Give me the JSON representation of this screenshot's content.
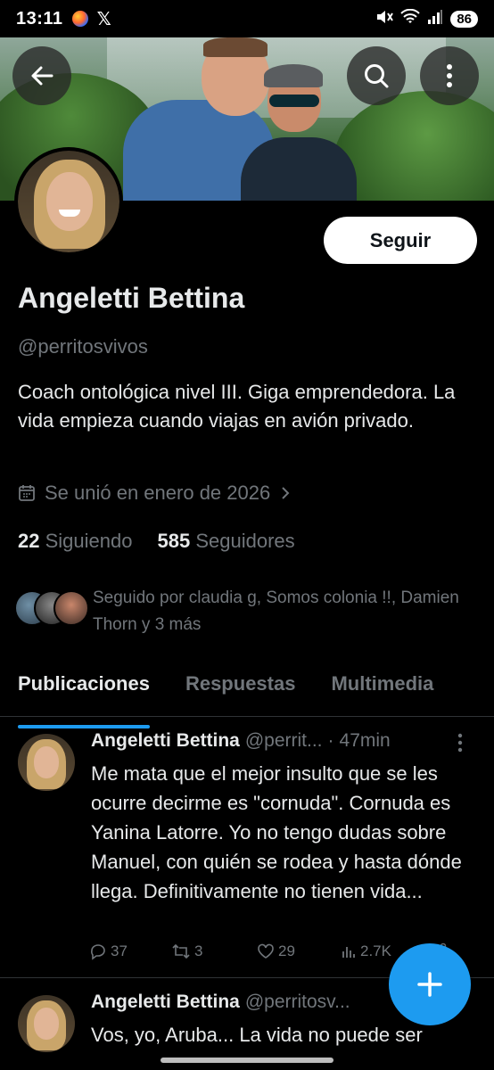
{
  "status_bar": {
    "time": "13:11",
    "app2": "𝕏",
    "battery": "86"
  },
  "profile": {
    "display_name": "Angeletti Bettina",
    "handle": "@perritosvivos",
    "bio": "Coach ontológica nivel III. Giga emprendedora. La vida empieza cuando viajas en avión privado.",
    "joined": "Se unió en enero de 2026",
    "following_count": "22",
    "following_label": "Siguiendo",
    "followers_count": "585",
    "followers_label": "Seguidores",
    "followed_by": "Seguido por claudia g, Somos colonia !!, Damien Thorn y 3 más",
    "follow_button": "Seguir"
  },
  "tabs": [
    {
      "label": "Publicaciones",
      "active": true
    },
    {
      "label": "Respuestas",
      "active": false
    },
    {
      "label": "Multimedia",
      "active": false
    }
  ],
  "posts": [
    {
      "name": "Angeletti Bettina",
      "handle": "@perrit...",
      "dot": "·",
      "time": "47min",
      "text": "Me mata que el mejor insulto que se les ocurre decirme es \"cornuda\". Cornuda es Yanina Latorre. Yo no tengo dudas sobre Manuel, con quién se rodea y hasta dónde llega. Definitivamente no tienen vida...",
      "replies": "37",
      "reposts": "3",
      "likes": "29",
      "views": "2.7K"
    },
    {
      "name": "Angeletti Bettina",
      "handle": "@perritosv...",
      "text": "Vos, yo, Aruba... La vida no puede ser"
    }
  ],
  "colors": {
    "background": "#000000",
    "primary_text": "#e7e9ea",
    "secondary_text": "#71767b",
    "accent": "#1d9bf0",
    "divider": "#2f3336"
  },
  "icons": [
    "back-arrow-icon",
    "search-icon",
    "more-vertical-icon",
    "calendar-icon",
    "chevron-right-icon",
    "reply-icon",
    "repost-icon",
    "like-icon",
    "views-icon",
    "share-icon",
    "plus-icon"
  ]
}
